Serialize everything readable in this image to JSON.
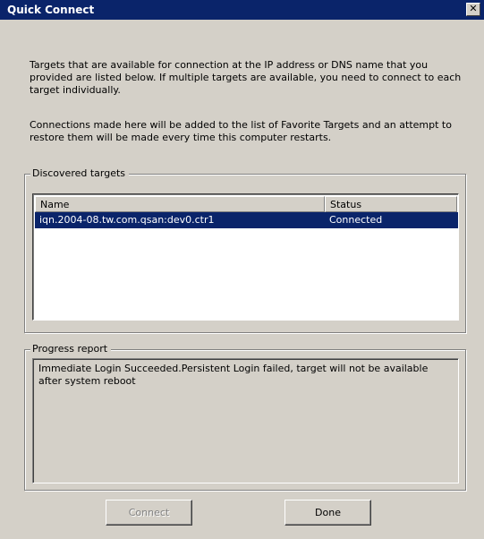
{
  "window": {
    "title": "Quick Connect",
    "close_glyph": "✕"
  },
  "intro": {
    "paragraph1": "Targets that are available for connection at the IP address or DNS name that you provided are listed below.  If multiple targets are available, you need to connect to each target individually.",
    "paragraph2": "Connections made here will be added to the list of Favorite Targets and an attempt to restore them will be made every time this computer restarts."
  },
  "discovered": {
    "legend": "Discovered targets",
    "columns": [
      "Name",
      "Status"
    ],
    "rows": [
      {
        "name": "iqn.2004-08.tw.com.qsan:dev0.ctr1",
        "status": "Connected",
        "selected": true
      }
    ]
  },
  "progress": {
    "legend": "Progress report",
    "text": "Immediate Login Succeeded.Persistent Login failed, target will not be available after system reboot"
  },
  "buttons": {
    "connect": "Connect",
    "done": "Done"
  },
  "colors": {
    "titlebar": "#0a246a",
    "dialog_face": "#d4d0c8",
    "selection": "#0a246a"
  }
}
